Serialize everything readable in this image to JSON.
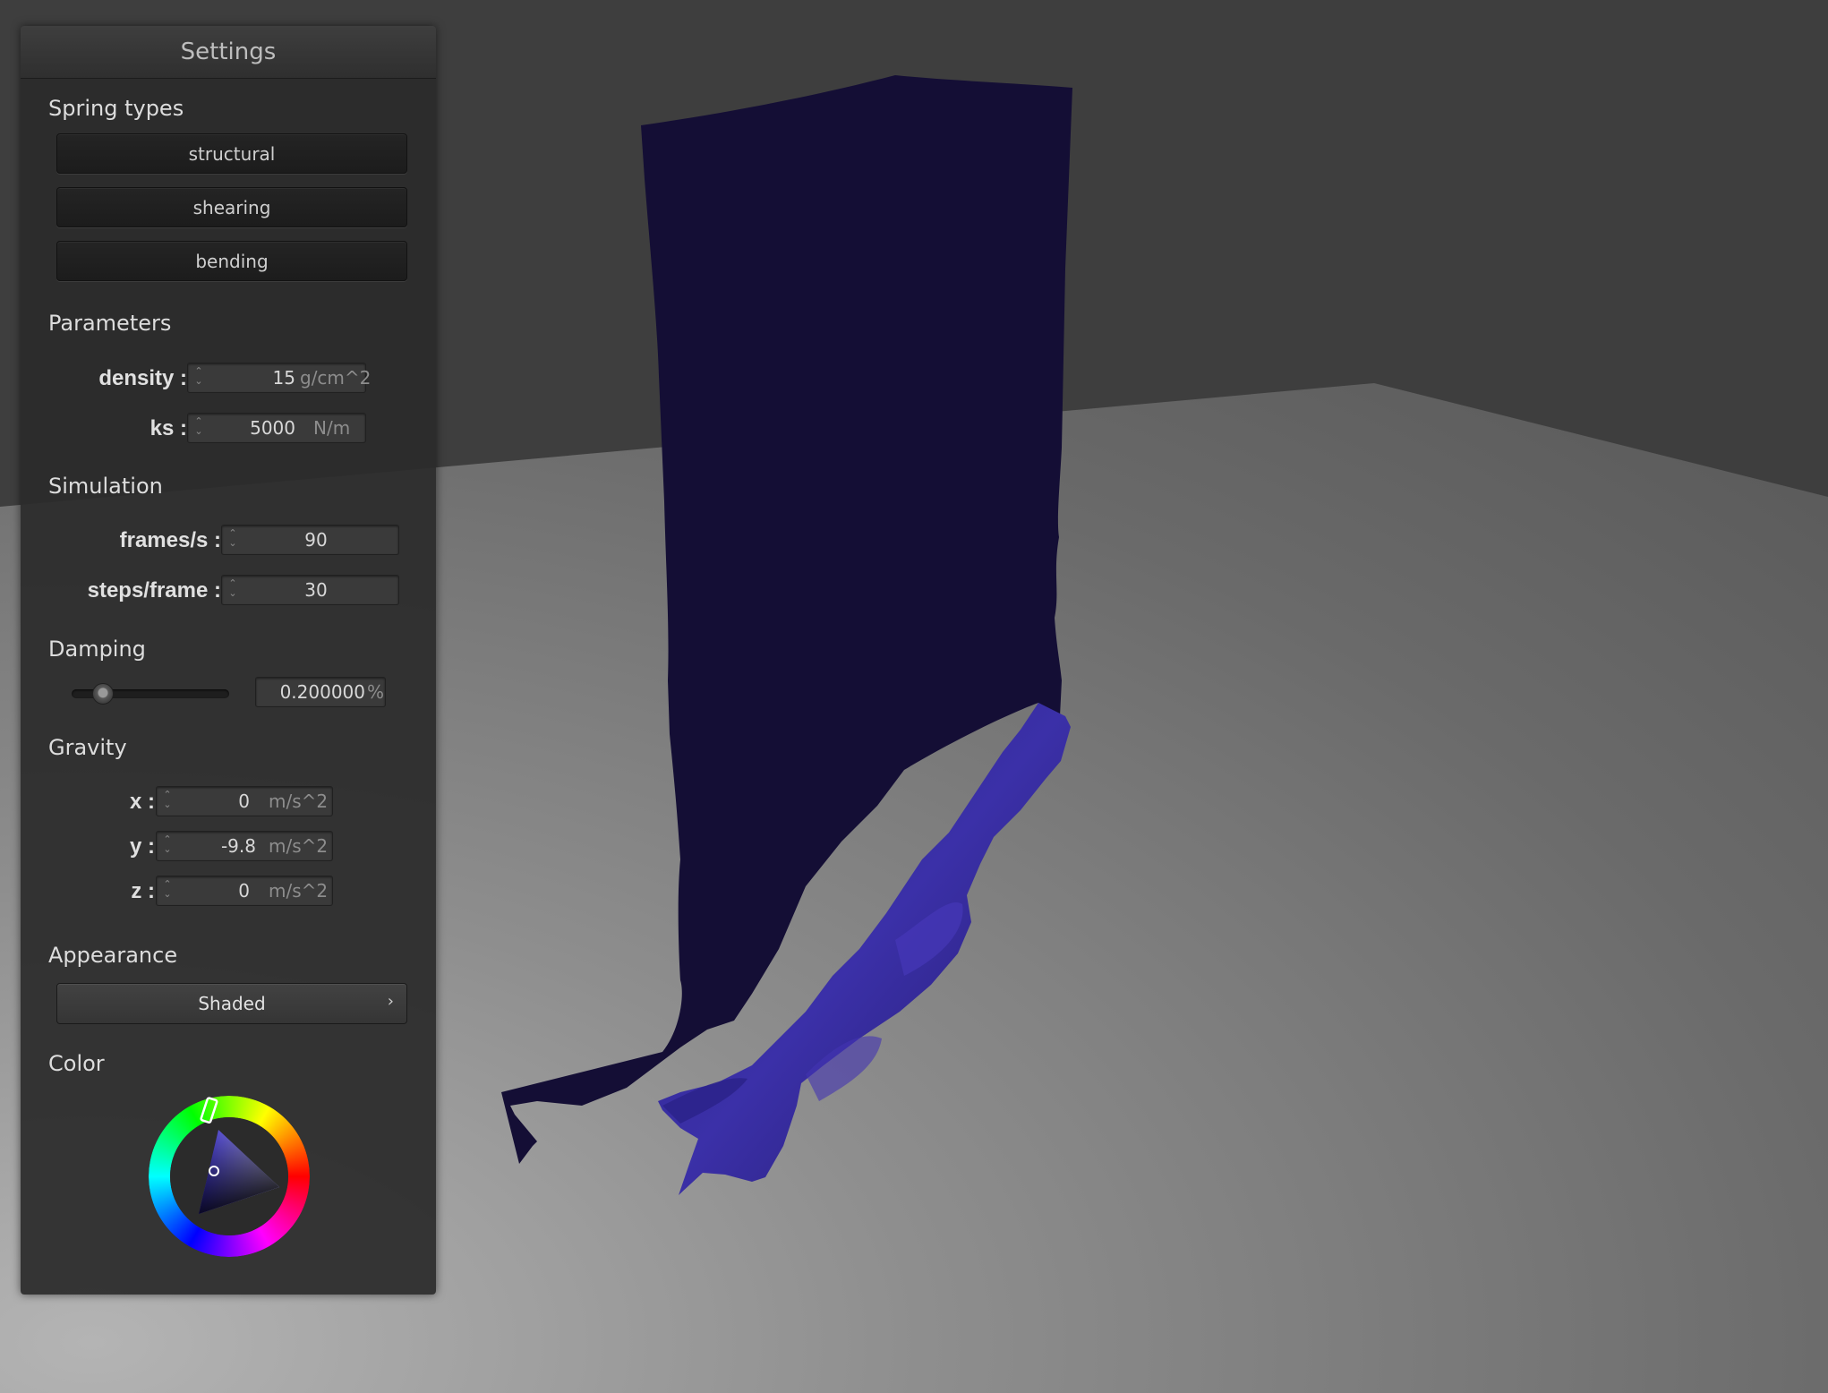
{
  "panel": {
    "title": "Settings",
    "spring_types": {
      "label": "Spring types",
      "buttons": [
        "structural",
        "shearing",
        "bending"
      ]
    },
    "parameters": {
      "label": "Parameters",
      "density": {
        "label": "density :",
        "value": "15",
        "unit": "g/cm^2"
      },
      "ks": {
        "label": "ks :",
        "value": "5000",
        "unit": "N/m"
      }
    },
    "simulation": {
      "label": "Simulation",
      "fps": {
        "label": "frames/s :",
        "value": "90"
      },
      "steps": {
        "label": "steps/frame :",
        "value": "30"
      }
    },
    "damping": {
      "label": "Damping",
      "slider_fraction": 0.2,
      "value": "0.200000",
      "unit": "%"
    },
    "gravity": {
      "label": "Gravity",
      "x": {
        "label": "x :",
        "value": "0",
        "unit": "m/s^2"
      },
      "y": {
        "label": "y :",
        "value": "-9.8",
        "unit": "m/s^2"
      },
      "z": {
        "label": "z :",
        "value": "0",
        "unit": "m/s^2"
      }
    },
    "appearance": {
      "label": "Appearance",
      "selected": "Shaded",
      "chevron_icon": "chevron-right-icon"
    },
    "color": {
      "label": "Color",
      "selected_color": "#3a2fb0"
    }
  },
  "scene": {
    "cloth_color": "#130d33",
    "cloth_highlight": "#3a2fa6",
    "background_color": "#3f3f3f",
    "floor_color": "#7a7a7a"
  }
}
